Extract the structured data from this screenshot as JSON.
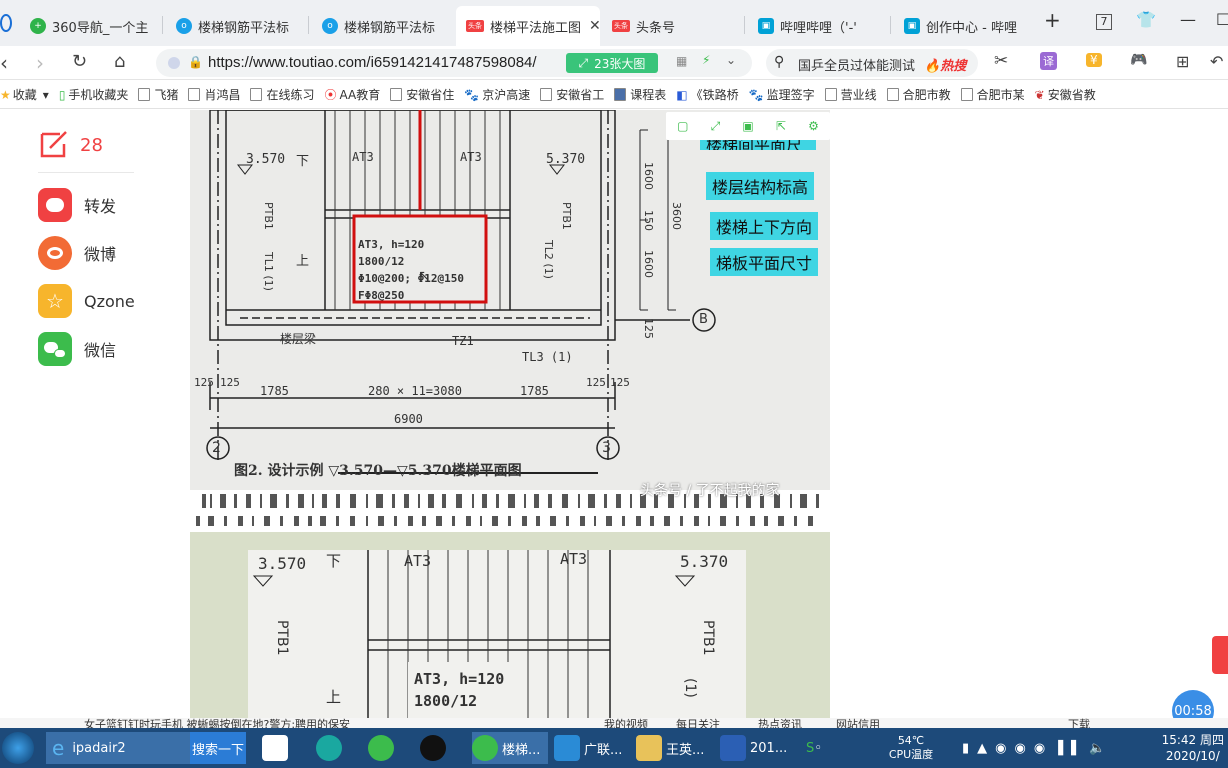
{
  "tabs": [
    {
      "title": "360导航_一个主",
      "color": "#2fb34a"
    },
    {
      "title": "楼梯钢筋平法标",
      "color": "#1aa0e8"
    },
    {
      "title": "楼梯钢筋平法标",
      "color": "#1aa0e8"
    },
    {
      "title": "楼梯平法施工图",
      "color": "#f04142",
      "active": true
    },
    {
      "title": "头条号",
      "color": "#f04142"
    },
    {
      "title": "哔哩哔哩（'-'",
      "color": "#00a1d6"
    },
    {
      "title": "创作中心 - 哔哩",
      "color": "#00a1d6"
    }
  ],
  "tab_count": "7",
  "url": "https://www.toutiao.com/i6591421417487598084/",
  "image_count_label": "23张大图",
  "search": {
    "query": "国乒全员过体能测试",
    "hot_label": "热搜"
  },
  "bookmarks": [
    "收藏",
    "手机收藏夹",
    "飞猪",
    "肖鸿昌",
    "在线练习",
    "AA教育",
    "安徽省住",
    "京沪高速",
    "安徽省工",
    "课程表",
    "《铁路桥",
    "监理签字",
    "营业线",
    "合肥市教",
    "合肥市某",
    "安徽省教"
  ],
  "share": {
    "comment_count": "28",
    "items": [
      {
        "label": "转发",
        "color": "#f04142",
        "icon": "forward-icon"
      },
      {
        "label": "微博",
        "color": "#f26b35",
        "icon": "weibo-icon"
      },
      {
        "label": "Qzone",
        "color": "#f7b52c",
        "icon": "qzone-icon"
      },
      {
        "label": "微信",
        "color": "#3cbc4c",
        "icon": "wechat-icon"
      }
    ]
  },
  "drawing": {
    "callouts": [
      "楼梯间平面尺寸",
      "楼层结构标高",
      "楼梯上下方向",
      "梯板平面尺寸"
    ],
    "elev_left": "3.570",
    "elev_right": "5.370",
    "at3": "AT3",
    "down": "下",
    "up": "上",
    "ptb1": "PTB1",
    "tl1": "TL1 (1)",
    "tl2": "TL2 (1)",
    "tl3": "TL3 (1)",
    "tz1": "TZ1",
    "beam": "楼层梁",
    "spec_lines": [
      "AT3, h=120",
      "1800/12",
      "Φ10@200; Φ12@150",
      "FΦ8@250"
    ],
    "dims": [
      "125",
      "125",
      "1785",
      "280 × 11=3080",
      "1785",
      "125",
      "125"
    ],
    "total_width": "6900",
    "axis_left": "2",
    "axis_right": "3",
    "axis_b": "B",
    "right_dims": [
      "1600",
      "150",
      "1600",
      "3600",
      "125"
    ],
    "caption": "图2. 设计示例  ▽3.570—▽5.370楼梯平面图",
    "watermark": "头条号 / 了不起我的家",
    "lower_spec": [
      "AT3, h=120",
      "1800/12"
    ],
    "lower_tl": "(1)"
  },
  "ticker": [
    "女子篮钉钉时玩手机 被蜥蜴按倒在地?警方:聘用的保安",
    "我的视频",
    "每日关注",
    "热点资讯",
    "网站信用",
    "下载"
  ],
  "timer": "00:58",
  "taskbar": {
    "items": [
      "ipadair2",
      "搜索一下",
      "楼梯...",
      "广联...",
      "王英...",
      "201..."
    ],
    "temp": "54℃",
    "temp_label": "CPU温度",
    "time": "15:42 周四",
    "date": "2020/10/"
  }
}
